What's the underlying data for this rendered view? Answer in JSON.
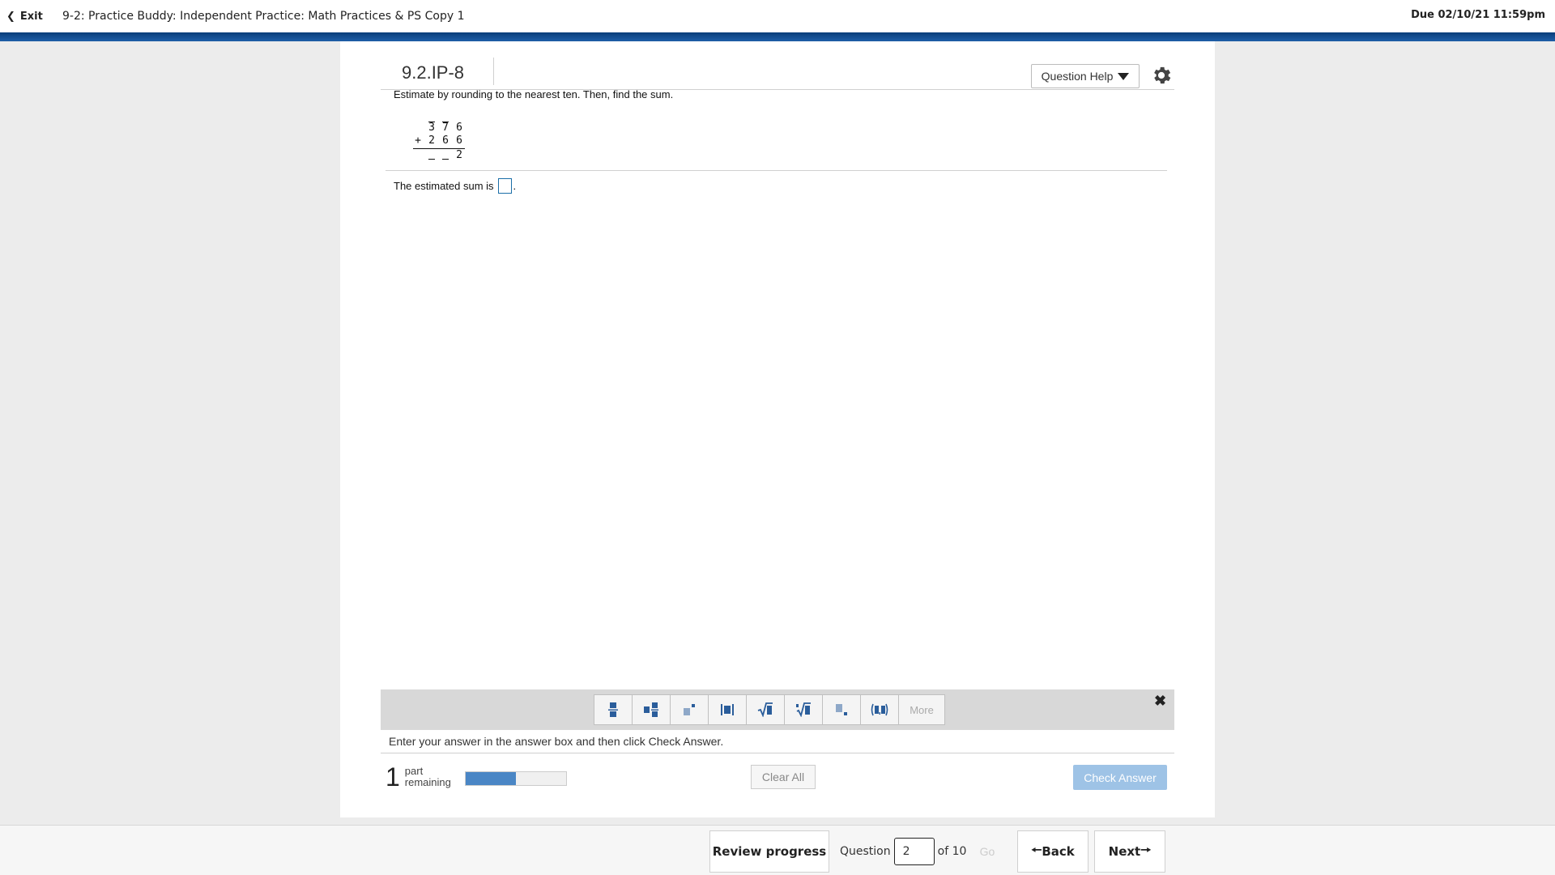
{
  "topbar": {
    "exit_label": "Exit",
    "assignment_title": "9-2: Practice Buddy: Independent Practice: Math Practices & PS Copy 1",
    "due": "Due 02/10/21 11:59pm"
  },
  "question": {
    "id": "9.2.IP-8",
    "help_label": "Question Help",
    "instruction": "Estimate by rounding to the nearest ten. Then, find the sum.",
    "problem": {
      "top_digits": [
        "3",
        "7",
        "6"
      ],
      "operator": "+",
      "bottom_digits": [
        "2",
        "6",
        "6"
      ],
      "result_digit": "2"
    },
    "answer_prompt": "The estimated sum is",
    "answer_suffix": "."
  },
  "palette": {
    "more_label": "More",
    "tools": [
      "fraction-icon",
      "mixed-number-icon",
      "exponent-icon",
      "absolute-value-icon",
      "square-root-icon",
      "nth-root-icon",
      "subscript-icon",
      "ordered-pair-icon"
    ]
  },
  "hint": "Enter your answer in the answer box and then click Check Answer.",
  "parts": {
    "count": "1",
    "line1": "part",
    "line2": "remaining",
    "progress_fraction": 0.5
  },
  "actions": {
    "clear_all": "Clear All",
    "check_answer": "Check Answer"
  },
  "bottombar": {
    "review_progress": "Review progress",
    "question_label": "Question",
    "question_number": "2",
    "of_total": "of 10",
    "go": "Go",
    "back": "Back",
    "next": "Next"
  }
}
